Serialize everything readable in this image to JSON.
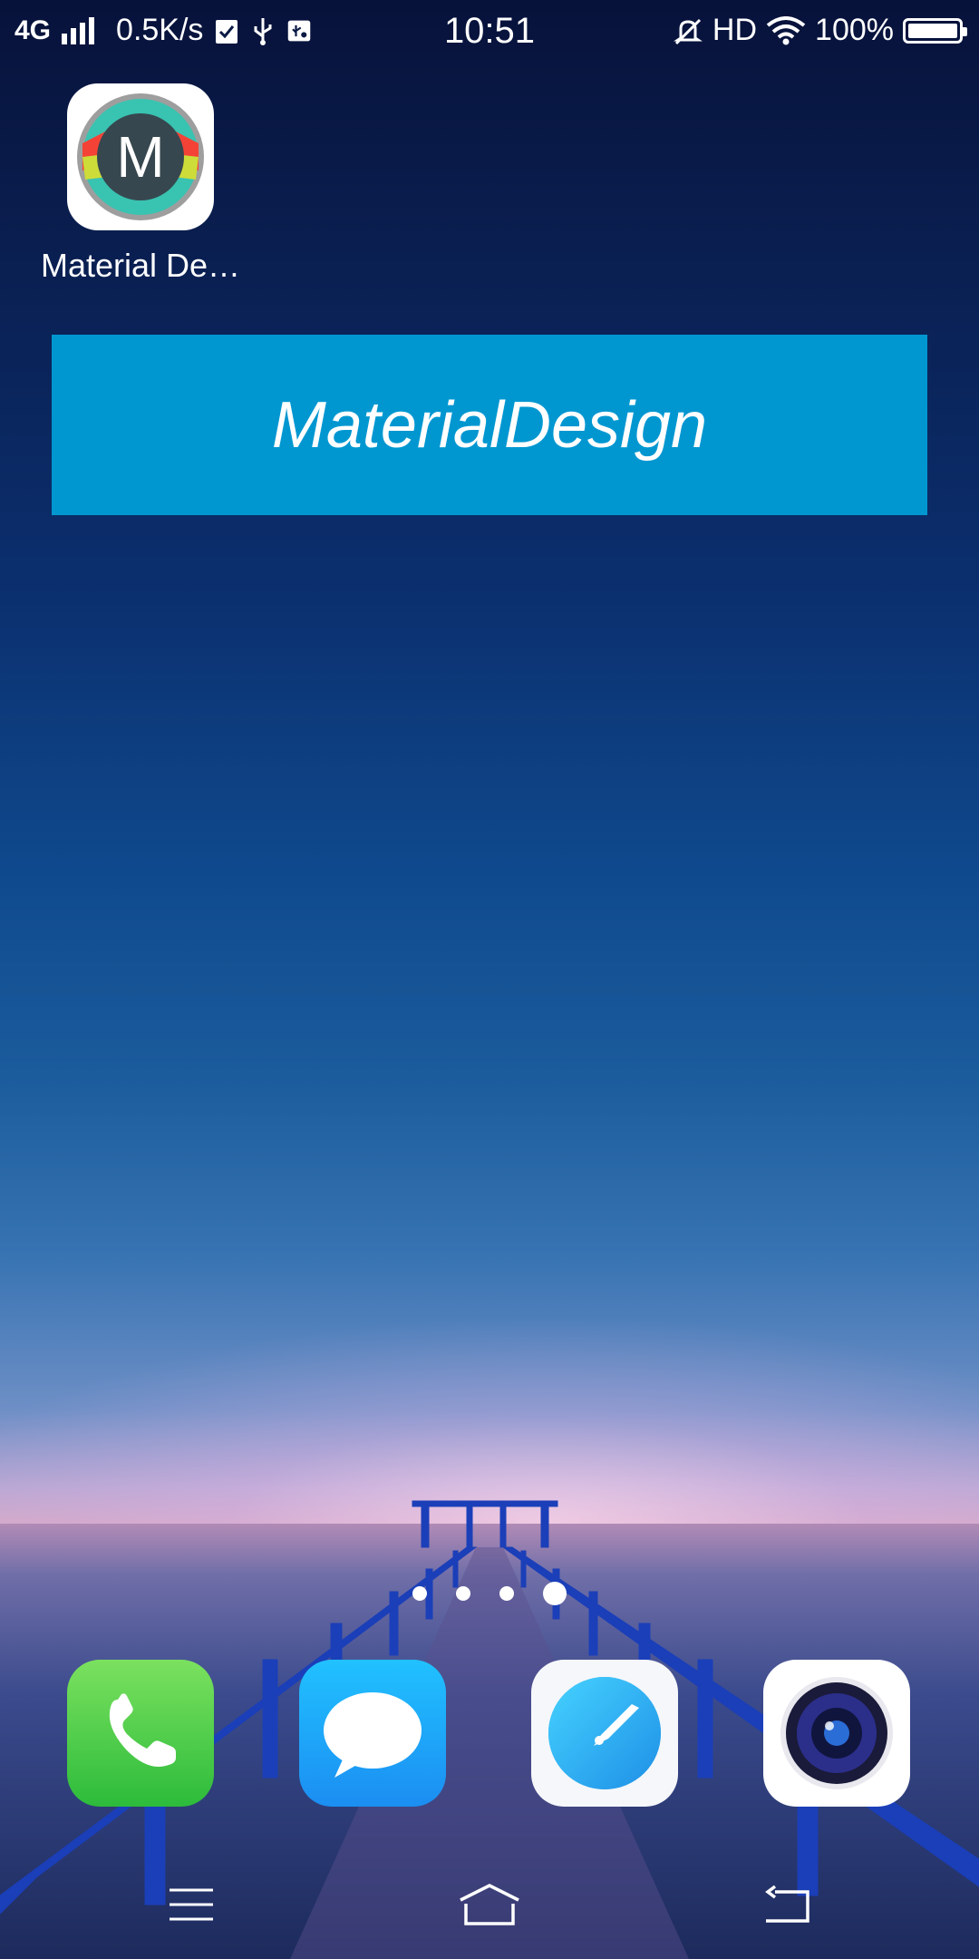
{
  "status_bar": {
    "network": "4G",
    "speed": "0.5K/s",
    "time": "10:51",
    "hd": "HD",
    "battery": "100%"
  },
  "home": {
    "app_shortcut": {
      "label": "Material De…",
      "icon": "m-app-icon",
      "letter": "M"
    },
    "widget": {
      "title": "MaterialDesign"
    },
    "pages": {
      "count": 4,
      "active_index": 3
    }
  },
  "dock": [
    {
      "name": "phone",
      "icon": "phone-icon"
    },
    {
      "name": "messages",
      "icon": "messages-icon"
    },
    {
      "name": "browser",
      "icon": "compass-icon"
    },
    {
      "name": "camera",
      "icon": "camera-icon"
    }
  ],
  "nav": [
    "menu-icon",
    "home-icon",
    "back-icon"
  ],
  "colors": {
    "widget_bg": "#0097d1",
    "phone_green": "#2dbb3b",
    "message_blue": "#1b8ef2"
  }
}
